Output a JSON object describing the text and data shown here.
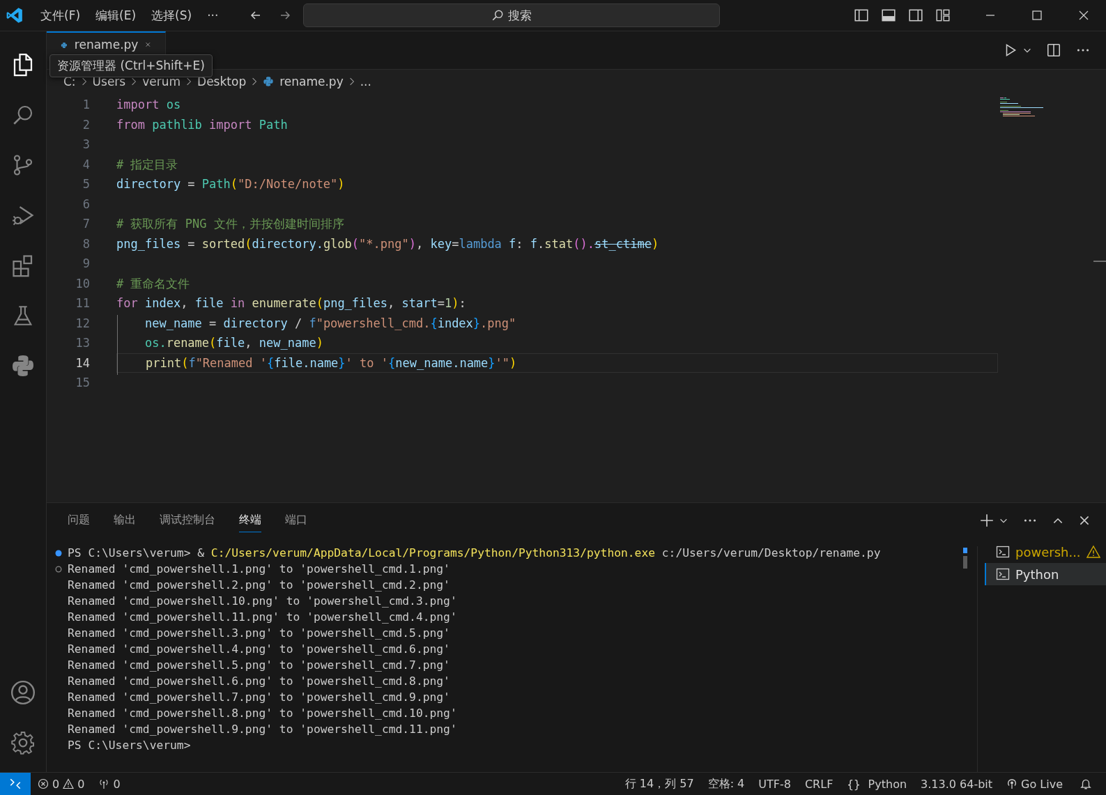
{
  "title_bar": {
    "menus": [
      "文件(F)",
      "编辑(E)",
      "选择(S)",
      "···"
    ],
    "search": {
      "placeholder": "搜索"
    }
  },
  "activity_bar": {
    "items": [
      {
        "kind": "files",
        "selected": true
      },
      {
        "kind": "search",
        "selected": false
      },
      {
        "kind": "source-control",
        "selected": false
      },
      {
        "kind": "run-debug",
        "selected": false
      },
      {
        "kind": "extensions",
        "selected": false
      },
      {
        "kind": "testing",
        "selected": false
      },
      {
        "kind": "python",
        "selected": false
      }
    ],
    "bottom": [
      {
        "kind": "account"
      },
      {
        "kind": "settings"
      }
    ]
  },
  "tooltip": "资源管理器 (Ctrl+Shift+E)",
  "tabs": [
    {
      "label": "rename.py",
      "selected": true
    }
  ],
  "breadcrumb": [
    "C:",
    "Users",
    "verum",
    "Desktop",
    "rename.py",
    "..."
  ],
  "code": [
    {
      "number": "1",
      "current": false,
      "tokens": [
        {
          "t": "import ",
          "color": "#c586c0"
        },
        {
          "t": "os",
          "color": "#4ec9b0"
        }
      ]
    },
    {
      "number": "2",
      "current": false,
      "tokens": [
        {
          "t": "from ",
          "color": "#c586c0"
        },
        {
          "t": "pathlib ",
          "color": "#4ec9b0"
        },
        {
          "t": "import ",
          "color": "#c586c0"
        },
        {
          "t": "Path",
          "color": "#4ec9b0"
        }
      ]
    },
    {
      "number": "3",
      "current": false
    },
    {
      "number": "4",
      "current": false,
      "tokens": [
        {
          "t": "# 指定目录",
          "color": "#6a9955"
        }
      ]
    },
    {
      "number": "5",
      "current": false,
      "tokens": [
        {
          "t": "directory",
          "color": "#9cdcfe"
        },
        {
          "t": " = ",
          "color": "#cccccc"
        },
        {
          "t": "Path",
          "color": "#4ec9b0"
        },
        {
          "t": "(",
          "color": "#ffd700"
        },
        {
          "t": "\"D:/Note/note\"",
          "color": "#ce9178"
        },
        {
          "t": ")",
          "color": "#ffd700"
        }
      ]
    },
    {
      "number": "6",
      "current": false
    },
    {
      "number": "7",
      "current": false,
      "tokens": [
        {
          "t": "# 获取所有 PNG 文件，并按创建时间排序",
          "color": "#6a9955"
        }
      ]
    },
    {
      "number": "8",
      "current": false,
      "tokens": [
        {
          "t": "png_files",
          "color": "#9cdcfe",
          "deprecated": false
        },
        {
          "t": " = ",
          "color": "#cccccc",
          "deprecated": false
        },
        {
          "t": "sorted",
          "color": "#dcdcaa",
          "deprecated": false
        },
        {
          "t": "(",
          "color": "#ffd700",
          "deprecated": false
        },
        {
          "t": "directory.",
          "color": "#9cdcfe",
          "deprecated": false
        },
        {
          "t": "glob",
          "color": "#dcdcaa",
          "deprecated": false
        },
        {
          "t": "(",
          "color": "#da70d6",
          "deprecated": false
        },
        {
          "t": "\"*.png\"",
          "color": "#ce9178",
          "deprecated": false
        },
        {
          "t": ")",
          "color": "#da70d6",
          "deprecated": false
        },
        {
          "t": ", ",
          "color": "#cccccc",
          "deprecated": false
        },
        {
          "t": "key",
          "color": "#9cdcfe",
          "deprecated": false
        },
        {
          "t": "=",
          "color": "#cccccc",
          "deprecated": false
        },
        {
          "t": "lambda ",
          "color": "#569cd6",
          "deprecated": false
        },
        {
          "t": "f",
          "color": "#9cdcfe",
          "deprecated": false
        },
        {
          "t": ": ",
          "color": "#cccccc",
          "deprecated": false
        },
        {
          "t": "f",
          "color": "#9cdcfe",
          "deprecated": false
        },
        {
          "t": ".",
          "color": "#cccccc",
          "deprecated": false
        },
        {
          "t": "stat",
          "color": "#dcdcaa",
          "deprecated": false
        },
        {
          "t": "().",
          "color": "#da70d6",
          "deprecated": false
        },
        {
          "t": "st_ctime",
          "color": "#9cdcfe",
          "deprecated": true
        },
        {
          "t": ")",
          "color": "#ffd700",
          "deprecated": false
        }
      ]
    },
    {
      "number": "9",
      "current": false
    },
    {
      "number": "10",
      "current": false,
      "tokens": [
        {
          "t": "# 重命名文件",
          "color": "#6a9955"
        }
      ]
    },
    {
      "number": "11",
      "current": false,
      "tokens": [
        {
          "t": "for ",
          "color": "#c586c0"
        },
        {
          "t": "index",
          "color": "#9cdcfe"
        },
        {
          "t": ", ",
          "color": "#cccccc"
        },
        {
          "t": "file ",
          "color": "#9cdcfe"
        },
        {
          "t": "in ",
          "color": "#c586c0"
        },
        {
          "t": "enumerate",
          "color": "#dcdcaa"
        },
        {
          "t": "(",
          "color": "#ffd700"
        },
        {
          "t": "png_files",
          "color": "#9cdcfe"
        },
        {
          "t": ", ",
          "color": "#cccccc"
        },
        {
          "t": "start",
          "color": "#9cdcfe"
        },
        {
          "t": "=",
          "color": "#cccccc"
        },
        {
          "t": "1",
          "color": "#b5cea8"
        },
        {
          "t": ")",
          "color": "#ffd700"
        },
        {
          "t": ":",
          "color": "#cccccc"
        }
      ]
    },
    {
      "number": "12",
      "current": false,
      "tokens": [
        {
          "t": "    new_name",
          "color": "#9cdcfe"
        },
        {
          "t": " = ",
          "color": "#cccccc"
        },
        {
          "t": "directory",
          "color": "#9cdcfe"
        },
        {
          "t": " / ",
          "color": "#cccccc"
        },
        {
          "t": "f",
          "color": "#569cd6"
        },
        {
          "t": "\"powershell_cmd.",
          "color": "#ce9178"
        },
        {
          "t": "{",
          "color": "#179fff"
        },
        {
          "t": "index",
          "color": "#9cdcfe"
        },
        {
          "t": "}",
          "color": "#179fff"
        },
        {
          "t": ".png\"",
          "color": "#ce9178"
        }
      ]
    },
    {
      "number": "13",
      "current": false,
      "tokens": [
        {
          "t": "    os.",
          "color": "#4ec9b0"
        },
        {
          "t": "rename",
          "color": "#dcdcaa"
        },
        {
          "t": "(",
          "color": "#ffd700"
        },
        {
          "t": "file",
          "color": "#9cdcfe"
        },
        {
          "t": ", ",
          "color": "#cccccc"
        },
        {
          "t": "new_name",
          "color": "#9cdcfe"
        },
        {
          "t": ")",
          "color": "#ffd700"
        }
      ]
    },
    {
      "number": "14",
      "current": true,
      "tokens": [
        {
          "t": "    print",
          "color": "#dcdcaa"
        },
        {
          "t": "(",
          "color": "#ffd700"
        },
        {
          "t": "f",
          "color": "#569cd6"
        },
        {
          "t": "\"Renamed '",
          "color": "#ce9178"
        },
        {
          "t": "{",
          "color": "#179fff"
        },
        {
          "t": "file.name",
          "color": "#9cdcfe"
        },
        {
          "t": "}",
          "color": "#179fff"
        },
        {
          "t": "' to '",
          "color": "#ce9178"
        },
        {
          "t": "{",
          "color": "#179fff"
        },
        {
          "t": "new_name.name",
          "color": "#9cdcfe"
        },
        {
          "t": "}",
          "color": "#179fff"
        },
        {
          "t": "'\"",
          "color": "#ce9178"
        },
        {
          "t": ")",
          "color": "#ffd700"
        }
      ]
    },
    {
      "number": "15",
      "current": false
    }
  ],
  "panel": {
    "tabs": [
      {
        "label": "问题",
        "selected": false
      },
      {
        "label": "输出",
        "selected": false
      },
      {
        "label": "调试控制台",
        "selected": false
      },
      {
        "label": "终端",
        "selected": true
      },
      {
        "label": "端口",
        "selected": false
      }
    ],
    "terminal": [
      {
        "kind": "succeeded-command",
        "parts": [
          {
            "t": "PS C:\\Users\\verum> & ",
            "color": "#cccccc"
          },
          {
            "t": "C:/Users/verum/AppData/Local/Programs/Python/Python313/python.exe",
            "color": "#f1e05a"
          },
          {
            "t": " c:/Users/verum/Desktop/rename.py",
            "color": "#cccccc"
          }
        ]
      },
      {
        "kind": "marked-output",
        "parts": [
          {
            "t": "Renamed 'cmd_powershell.1.png' to 'powershell_cmd.1.png'",
            "color": "#cccccc"
          }
        ]
      },
      {
        "kind": "output",
        "parts": [
          {
            "t": "Renamed 'cmd_powershell.2.png' to 'powershell_cmd.2.png'",
            "color": "#cccccc"
          }
        ]
      },
      {
        "kind": "output",
        "parts": [
          {
            "t": "Renamed 'cmd_powershell.10.png' to 'powershell_cmd.3.png'",
            "color": "#cccccc"
          }
        ]
      },
      {
        "kind": "output",
        "parts": [
          {
            "t": "Renamed 'cmd_powershell.11.png' to 'powershell_cmd.4.png'",
            "color": "#cccccc"
          }
        ]
      },
      {
        "kind": "output",
        "parts": [
          {
            "t": "Renamed 'cmd_powershell.3.png' to 'powershell_cmd.5.png'",
            "color": "#cccccc"
          }
        ]
      },
      {
        "kind": "output",
        "parts": [
          {
            "t": "Renamed 'cmd_powershell.4.png' to 'powershell_cmd.6.png'",
            "color": "#cccccc"
          }
        ]
      },
      {
        "kind": "output",
        "parts": [
          {
            "t": "Renamed 'cmd_powershell.5.png' to 'powershell_cmd.7.png'",
            "color": "#cccccc"
          }
        ]
      },
      {
        "kind": "output",
        "parts": [
          {
            "t": "Renamed 'cmd_powershell.6.png' to 'powershell_cmd.8.png'",
            "color": "#cccccc"
          }
        ]
      },
      {
        "kind": "output",
        "parts": [
          {
            "t": "Renamed 'cmd_powershell.7.png' to 'powershell_cmd.9.png'",
            "color": "#cccccc"
          }
        ]
      },
      {
        "kind": "output",
        "parts": [
          {
            "t": "Renamed 'cmd_powershell.8.png' to 'powershell_cmd.10.png'",
            "color": "#cccccc"
          }
        ]
      },
      {
        "kind": "output",
        "parts": [
          {
            "t": "Renamed 'cmd_powershell.9.png' to 'powershell_cmd.11.png'",
            "color": "#cccccc"
          }
        ]
      },
      {
        "kind": "output",
        "parts": [
          {
            "t": "PS C:\\Users\\verum>",
            "color": "#cccccc"
          }
        ]
      }
    ],
    "sessions": [
      {
        "label": "powersh...",
        "warning": true,
        "selected": false
      },
      {
        "label": "Python",
        "warning": false,
        "selected": true
      }
    ]
  },
  "status_bar": {
    "errors": "0",
    "warnings": "0",
    "ports": "0",
    "right": [
      {
        "kind": "text",
        "text": "行 14，列 57"
      },
      {
        "kind": "text",
        "text": "空格: 4"
      },
      {
        "kind": "text",
        "text": "UTF-8"
      },
      {
        "kind": "text",
        "text": "CRLF"
      },
      {
        "kind": "language",
        "icon": "{}",
        "text": "Python"
      },
      {
        "kind": "text",
        "text": "3.13.0 64-bit"
      },
      {
        "kind": "live",
        "text": "Go Live"
      }
    ]
  }
}
